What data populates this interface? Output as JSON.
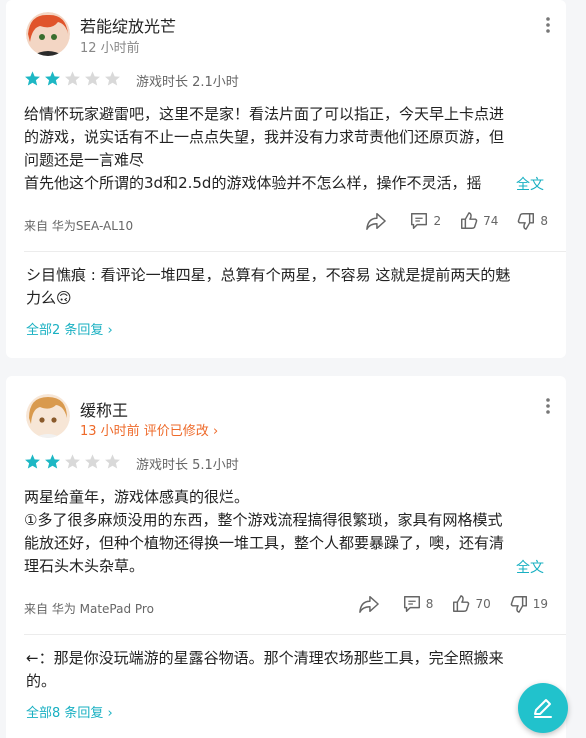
{
  "reviews": [
    {
      "username": "若能绽放光芒",
      "time": "12 小时前",
      "rating": 2,
      "playtime": "游戏时长 2.1小时",
      "body_lines": [
        "给情怀玩家避雷吧，这里不是家！看法片面了可以指正，今天早上卡点进",
        "的游戏，说实话有不止一点点失望，我并没有力求苛责他们还原页游，但",
        "问题还是一言难尽",
        "首先他这个所谓的3d和2.5d的游戏体验并不怎么样，操作不灵活，摇"
      ],
      "fulltext": "全文",
      "device": "来自 华为SEA-AL10",
      "comments": "2",
      "likes": "74",
      "dislikes": "8",
      "reply_lines": [
        "シ目憔痕 : 看评论一堆四星，总算有个两星，不容易 这就是提前两天的魅",
        "力么🙃"
      ],
      "all_replies": "全部2 条回复 ›"
    },
    {
      "username": "缓称王",
      "time": "13 小时前 评价已修改 ›",
      "rating": 2,
      "playtime": "游戏时长 5.1小时",
      "body_lines": [
        "两星给童年，游戏体感真的很烂。",
        "①多了很多麻烦没用的东西，整个游戏流程搞得很繁琐，家具有网格模式",
        "能放还好，但种个植物还得换一堆工具，整个人都要暴躁了，噢，还有清",
        "理石头木头杂草。"
      ],
      "fulltext": "全文",
      "device": "来自 华为 MatePad Pro",
      "comments": "8",
      "likes": "70",
      "dislikes": "19",
      "reply_lines": [
        "←：那是你没玩端游的星露谷物语。那个清理农场那些工具，完全照搬来",
        "的。"
      ],
      "all_replies": "全部8 条回复 ›"
    }
  ],
  "colors": {
    "accent": "#19b0c2",
    "star_filled": "#1db7c4",
    "star_empty": "#d9d9d9",
    "edited": "#ee6a2a",
    "fab": "#21c2cc"
  },
  "icons": [
    "share-icon",
    "comment-icon",
    "thumbs-up-icon",
    "thumbs-down-icon",
    "more-vertical-icon",
    "edit-pen-icon"
  ]
}
